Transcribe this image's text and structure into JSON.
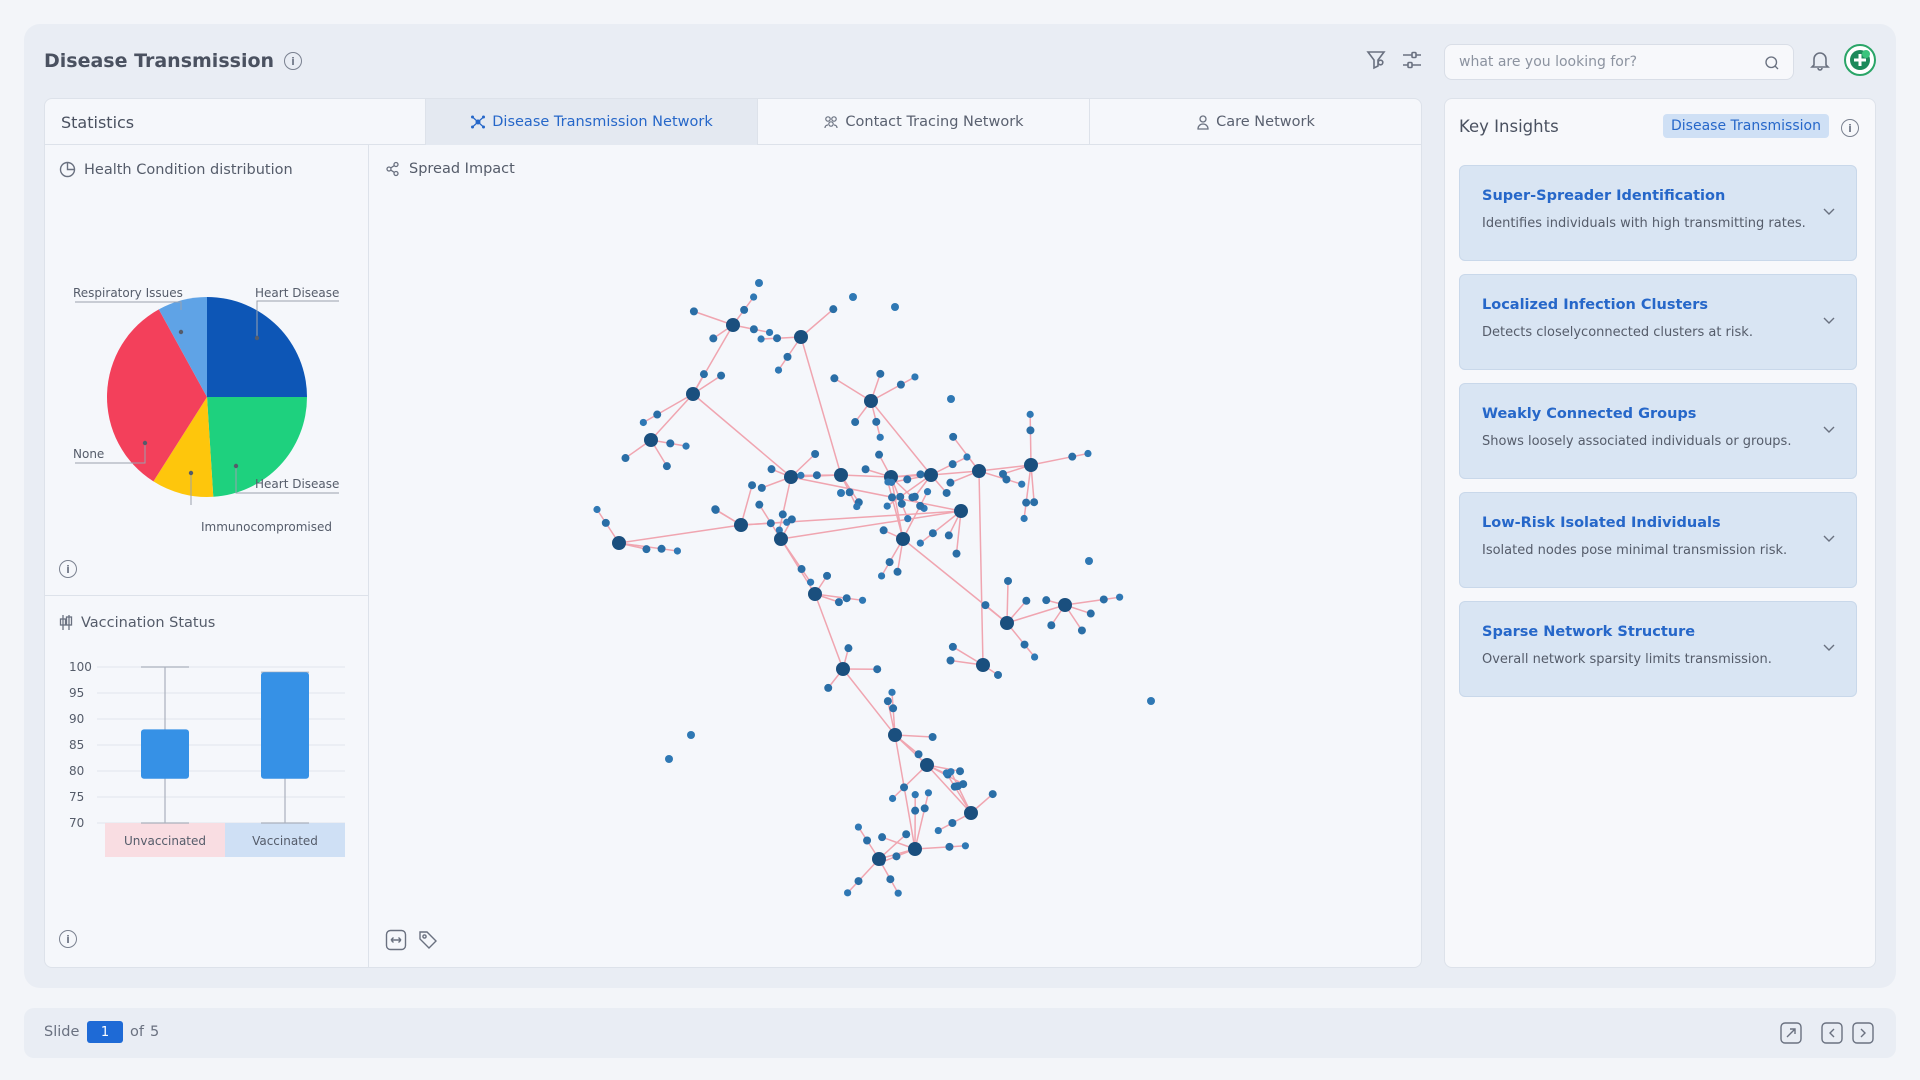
{
  "header": {
    "title": "Disease Transmission",
    "search_placeholder": "what are you looking for?"
  },
  "tabs": {
    "statistics_label": "Statistics",
    "items": [
      {
        "label": "Disease Transmission Network",
        "active": true,
        "icon": "network-icon"
      },
      {
        "label": "Contact Tracing Network",
        "active": false,
        "icon": "people-icon"
      },
      {
        "label": "Care Network",
        "active": false,
        "icon": "person-icon"
      }
    ]
  },
  "health": {
    "title": "Health Condition distribution",
    "chart_data": {
      "type": "pie",
      "slices": [
        {
          "label": "Heart Disease",
          "value": 25,
          "color": "#0d56b6"
        },
        {
          "label": "Heart Disease",
          "value": 24,
          "color": "#1ed17e"
        },
        {
          "label": "Immunocompromised",
          "value": 10,
          "color": "#fec60c"
        },
        {
          "label": "None",
          "value": 33,
          "color": "#f3405b"
        },
        {
          "label": "Respiratory Issues",
          "value": 8,
          "color": "#5fa3e6"
        }
      ]
    }
  },
  "vaccination": {
    "title": "Vaccination Status",
    "chart_data": {
      "type": "boxplot",
      "ylim": [
        70,
        100
      ],
      "yticks": [
        100,
        95,
        90,
        85,
        80,
        75,
        70
      ],
      "groups": [
        {
          "label": "Unvaccinated",
          "min": 70,
          "q1": 78.5,
          "q3": 88,
          "max": 100,
          "bg": "#f9dde2"
        },
        {
          "label": "Vaccinated",
          "min": 70,
          "q1": 78.5,
          "q3": 99,
          "max": 99,
          "bg": "#cfe0f5"
        }
      ]
    }
  },
  "spread": {
    "title": "Spread Impact"
  },
  "insights": {
    "title": "Key Insights",
    "badge": "Disease Transmission",
    "items": [
      {
        "title": "Super-Spreader Identification",
        "desc": "Identifies individuals with high transmitting rates."
      },
      {
        "title": "Localized Infection Clusters",
        "desc": "Detects closelyconnected clusters at risk."
      },
      {
        "title": "Weakly Connected Groups",
        "desc": "Shows loosely associated individuals or groups."
      },
      {
        "title": "Low-Risk Isolated Individuals",
        "desc": "Isolated nodes pose minimal transmission risk."
      },
      {
        "title": "Sparse Network Structure",
        "desc": "Overall network sparsity limits transmission."
      }
    ]
  },
  "footer": {
    "slide_label": "Slide",
    "page": "1",
    "of_label": "of",
    "total": "5"
  },
  "colors": {
    "accent": "#2667c9",
    "node": "#1b5a8a",
    "edge": "#f0a5b0"
  }
}
